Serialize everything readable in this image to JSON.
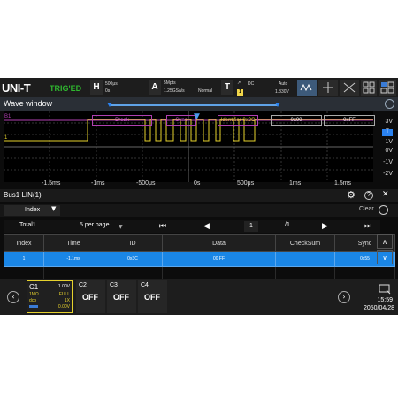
{
  "brand": {
    "logo": "UNI-T",
    "trigger_status": "TRIG'ED"
  },
  "topbar": {
    "horizontal": {
      "letter": "H",
      "timebase": "500μs",
      "offset": "0s"
    },
    "acquire": {
      "letter": "A",
      "memory": "5Mpts",
      "sample_rate": "1.25GSa/s",
      "mode": "Normal"
    },
    "trigger": {
      "letter": "T",
      "coupling": "DC",
      "source_badge": "1",
      "sweep": "Auto",
      "level": "1.830V"
    },
    "buttons": [
      "measure-icon",
      "cursor-icon",
      "math-icon",
      "menu-grid-icon"
    ]
  },
  "wave": {
    "title": "Wave window",
    "decode_labels": [
      "Break",
      "Sync",
      "Identifier 0x3C",
      "0x00",
      "0xFF"
    ],
    "bus_marker": "B1",
    "ch1_marker": "1",
    "volt_labels": [
      "3V",
      "2V",
      "1V",
      "0V",
      "-1V",
      "-2V"
    ],
    "time_labels": [
      "-1.5ms",
      "-1ms",
      "-500μs",
      "0s",
      "500μs",
      "1ms",
      "1.5ms"
    ]
  },
  "bus": {
    "title": "Bus1 LIN(1)",
    "filter_label": "Index",
    "clear_label": "Clear",
    "total": "Total1",
    "per_page": "5 per page",
    "page": "1",
    "page_total": "/1",
    "columns": [
      "Index",
      "Time",
      "ID",
      "Data",
      "CheckSum",
      "Sync"
    ],
    "rows": [
      {
        "index": "1",
        "time": "-1.1ms",
        "id": "0x3C",
        "data": "00 FF",
        "checksum": "",
        "sync": "0x55"
      }
    ]
  },
  "channels": {
    "ch1": {
      "name": "C1",
      "scale": "1.00V",
      "impedance": "1MΩ",
      "bandwidth": "FULL",
      "coupling": "dcp",
      "probe": "1X",
      "offset": "0.00V"
    },
    "others": [
      {
        "name": "C2",
        "state": "OFF"
      },
      {
        "name": "C3",
        "state": "OFF"
      },
      {
        "name": "C4",
        "state": "OFF"
      }
    ]
  },
  "clock": {
    "time": "15:59",
    "date": "2050/04/28"
  },
  "colors": {
    "ch1": "#e6d22d",
    "bus": "#b040b0",
    "accent": "#1a86e6",
    "trig_green": "#2fb52f"
  }
}
